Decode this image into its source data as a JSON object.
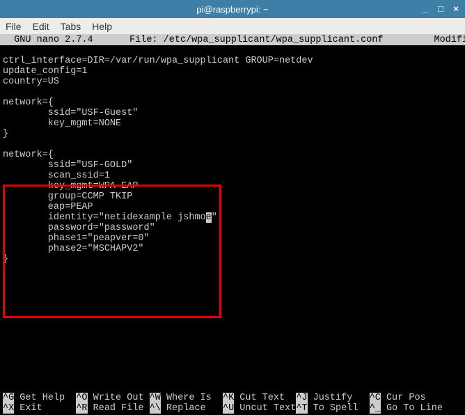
{
  "window": {
    "title": "pi@raspberrypi: ~"
  },
  "menubar": {
    "file": "File",
    "edit": "Edit",
    "tabs": "Tabs",
    "help": "Help"
  },
  "nano": {
    "version": "  GNU nano 2.7.4  ",
    "filepath": "  File: /etc/wpa_supplicant/wpa_supplicant.conf         ",
    "status": "Modified "
  },
  "content": {
    "line1": "ctrl_interface=DIR=/var/run/wpa_supplicant GROUP=netdev",
    "line2": "update_config=1",
    "line3": "country=US",
    "line4": "",
    "line5": "network={",
    "line6": "        ssid=\"USF-Guest\"",
    "line7": "        key_mgmt=NONE",
    "line8": "}",
    "line9": "",
    "line10": "network={",
    "line11": "        ssid=\"USF-GOLD\"",
    "line12": "        scan_ssid=1",
    "line13": "        key_mgmt=WPA-EAP",
    "line14": "        group=CCMP TKIP",
    "line15": "        eap=PEAP",
    "line16a": "        identity=\"netidexample jshmo",
    "line16b": "e",
    "line16c": "\"",
    "line17": "        password=\"password\"",
    "line18": "        phase1=\"peapver=0\"",
    "line19": "        phase2=\"MSCHAPV2\"",
    "line20": "}"
  },
  "footer": {
    "k1": "^G",
    "l1": " Get Help  ",
    "k2": "^O",
    "l2": " Write Out ",
    "k3": "^W",
    "l3": " Where Is  ",
    "k4": "^K",
    "l4": " Cut Text  ",
    "k5": "^J",
    "l5": " Justify   ",
    "k6": "^C",
    "l6": " Cur Pos",
    "k7": "^X",
    "l7": " Exit      ",
    "k8": "^R",
    "l8": " Read File ",
    "k9": "^\\",
    "l9": " Replace   ",
    "k10": "^U",
    "l10": " Uncut Text",
    "k11": "^T",
    "l11": " To Spell  ",
    "k12": "^_",
    "l12": " Go To Line"
  }
}
